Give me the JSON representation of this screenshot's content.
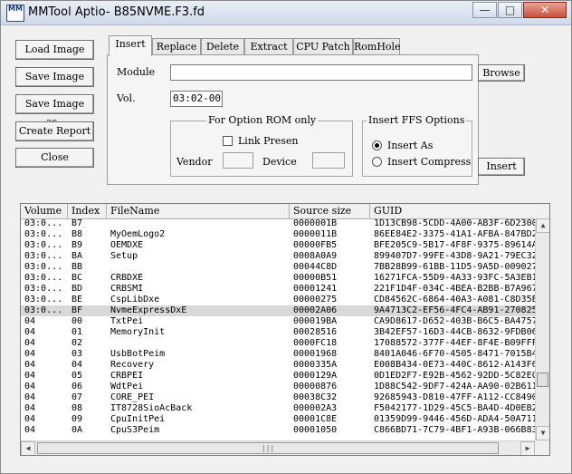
{
  "window": {
    "icon_text": "MM",
    "title": "MMTool Aptio- B85NVME.F3.fd",
    "minimize_glyph": "—",
    "maximize_glyph": "□",
    "close_glyph": "✕"
  },
  "side_buttons": {
    "load": "Load Image",
    "save": "Save Image",
    "save_as": "Save Image as..",
    "report": "Create Report",
    "close": "Close"
  },
  "tabs": [
    "Insert",
    "Replace",
    "Delete",
    "Extract",
    "CPU Patch",
    "RomHole"
  ],
  "insert": {
    "module_label": "Module",
    "module_value": "",
    "browse": "Browse",
    "vol_label": "Vol.",
    "vol_value": "03:02-00",
    "option_rom": {
      "title": "For Option ROM only",
      "link_present": "Link Presen",
      "vendor_label": "Vendor",
      "vendor_value": "",
      "device_label": "Device",
      "device_value": ""
    },
    "ffs": {
      "title": "Insert FFS Options",
      "insert_as": "Insert As",
      "insert_compress": "Insert Compress",
      "selected": "insert_as"
    },
    "insert_button": "Insert"
  },
  "table": {
    "columns": [
      "Volume",
      "Index",
      "FileName",
      "Source size",
      "GUID"
    ],
    "rows": [
      [
        "03:0...",
        "B7",
        "",
        "0000001B",
        "1D13CB98-5CDD-4A00-AB3F-6D2300"
      ],
      [
        "03:0...",
        "B8",
        "MyOemLogo2",
        "0000011B",
        "86EE84E2-3375-41A1-AFBA-847BD2"
      ],
      [
        "03:0...",
        "B9",
        "OEMDXE",
        "00000FB5",
        "BFE205C9-5B17-4F8F-9375-89614A"
      ],
      [
        "03:0...",
        "BA",
        "Setup",
        "0008A0A9",
        "899407D7-99FE-43D8-9A21-79EC32"
      ],
      [
        "03:0...",
        "BB",
        "",
        "00044C8D",
        "7BB28B99-61BB-11D5-9A5D-009027"
      ],
      [
        "03:0...",
        "BC",
        "CRBDXE",
        "00000B51",
        "16271FCA-55D9-4A33-93FC-5A3EB1"
      ],
      [
        "03:0...",
        "BD",
        "CRBSMI",
        "00001241",
        "221F1D4F-034C-4BEA-B2BB-B7A967"
      ],
      [
        "03:0...",
        "BE",
        "CspLibDxe",
        "00000275",
        "CD84562C-6864-40A3-A081-C8D35E"
      ],
      [
        "03:0...",
        "BF",
        "NvmeExpressDxE",
        "00002A06",
        "9A4713C2-EF56-4FC4-AB91-270825"
      ],
      [
        "04",
        "00",
        "TxtPei",
        "000019BA",
        "CA9D8617-D652-403B-B6C5-BA4757"
      ],
      [
        "04",
        "01",
        "MemoryInit",
        "00028516",
        "3B42EF57-16D3-44CB-8632-9FDB06"
      ],
      [
        "04",
        "02",
        "",
        "0000FC18",
        "17088572-377F-44EF-8F4E-B09FFF"
      ],
      [
        "04",
        "03",
        "UsbBotPeim",
        "00001968",
        "8401A046-6F70-4505-8471-7015B4"
      ],
      [
        "04",
        "04",
        "Recovery",
        "0000335A",
        "E008B434-0E73-440C-8612-A143F6"
      ],
      [
        "04",
        "05",
        "CRBPEI",
        "0000129A",
        "0D1ED2F7-E92B-4562-92DD-5C82EC"
      ],
      [
        "04",
        "06",
        "WdtPei",
        "00000876",
        "1D88C542-9DF7-424A-AA90-02B611"
      ],
      [
        "04",
        "07",
        "CORE_PEI",
        "00038C32",
        "92685943-D810-47FF-A112-CC8490"
      ],
      [
        "04",
        "08",
        "IT8728SioAcBack",
        "000002A3",
        "F5042177-1D29-45C5-BA4D-4D0EB2"
      ],
      [
        "04",
        "09",
        "CpuInitPei",
        "00001C8E",
        "01359D99-9446-456D-ADA4-50A711"
      ],
      [
        "04",
        "0A",
        "CpuS3Peim",
        "00001050",
        "C866BD71-7C79-4BF1-A93B-066B83"
      ]
    ],
    "selected_row": 8
  },
  "scroll_glyphs": {
    "up": "▲",
    "down": "▼",
    "left": "◀",
    "right": "▶",
    "grip": "|||"
  }
}
